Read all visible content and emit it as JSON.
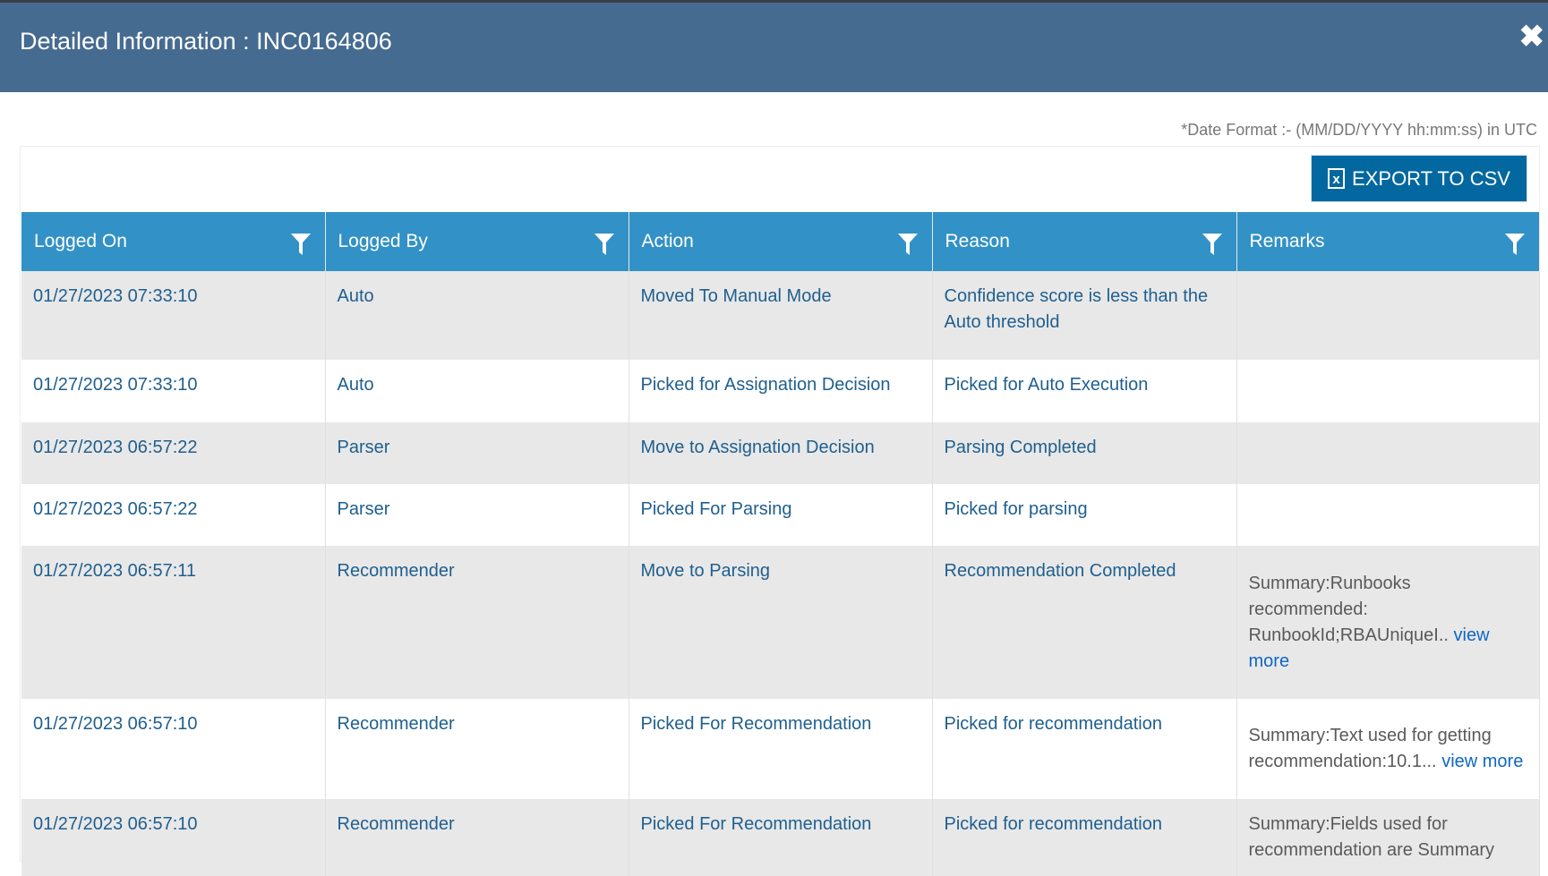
{
  "header": {
    "title": "Detailed Information : INC0164806",
    "close_icon": "close-icon"
  },
  "date_format": "*Date Format :- (MM/DD/YYYY hh:mm:ss) in UTC",
  "export": {
    "label": "EXPORT TO CSV",
    "icon": "excel-file-icon"
  },
  "columns": [
    "Logged On",
    "Logged By",
    "Action",
    "Reason",
    "Remarks"
  ],
  "rows": [
    {
      "logged_on": "01/27/2023 07:33:10",
      "logged_by": "Auto",
      "action": "Moved To Manual Mode",
      "reason": "Confidence score is less than the Auto threshold",
      "remarks": "",
      "link": ""
    },
    {
      "logged_on": "01/27/2023 07:33:10",
      "logged_by": "Auto",
      "action": "Picked for Assignation Decision",
      "reason": "Picked for Auto Execution",
      "remarks": "",
      "link": ""
    },
    {
      "logged_on": "01/27/2023 06:57:22",
      "logged_by": "Parser",
      "action": "Move to Assignation Decision",
      "reason": "Parsing Completed",
      "remarks": "",
      "link": ""
    },
    {
      "logged_on": "01/27/2023 06:57:22",
      "logged_by": "Parser",
      "action": "Picked For Parsing",
      "reason": "Picked for parsing",
      "remarks": "",
      "link": ""
    },
    {
      "logged_on": "01/27/2023 06:57:11",
      "logged_by": "Recommender",
      "action": "Move to Parsing",
      "reason": "Recommendation Completed",
      "remarks": "Summary:Runbooks recommended: RunbookId;RBAUniqueI.. ",
      "link": "view more"
    },
    {
      "logged_on": "01/27/2023 06:57:10",
      "logged_by": "Recommender",
      "action": "Picked For Recommendation",
      "reason": "Picked for recommendation",
      "remarks": "Summary:Text used for getting recommendation:10.1... ",
      "link": "view more"
    },
    {
      "logged_on": "01/27/2023 06:57:10",
      "logged_by": "Recommender",
      "action": "Picked For Recommendation",
      "reason": "Picked for recommendation",
      "remarks": "Summary:Fields used for recommendation are Summary",
      "link": ""
    }
  ]
}
